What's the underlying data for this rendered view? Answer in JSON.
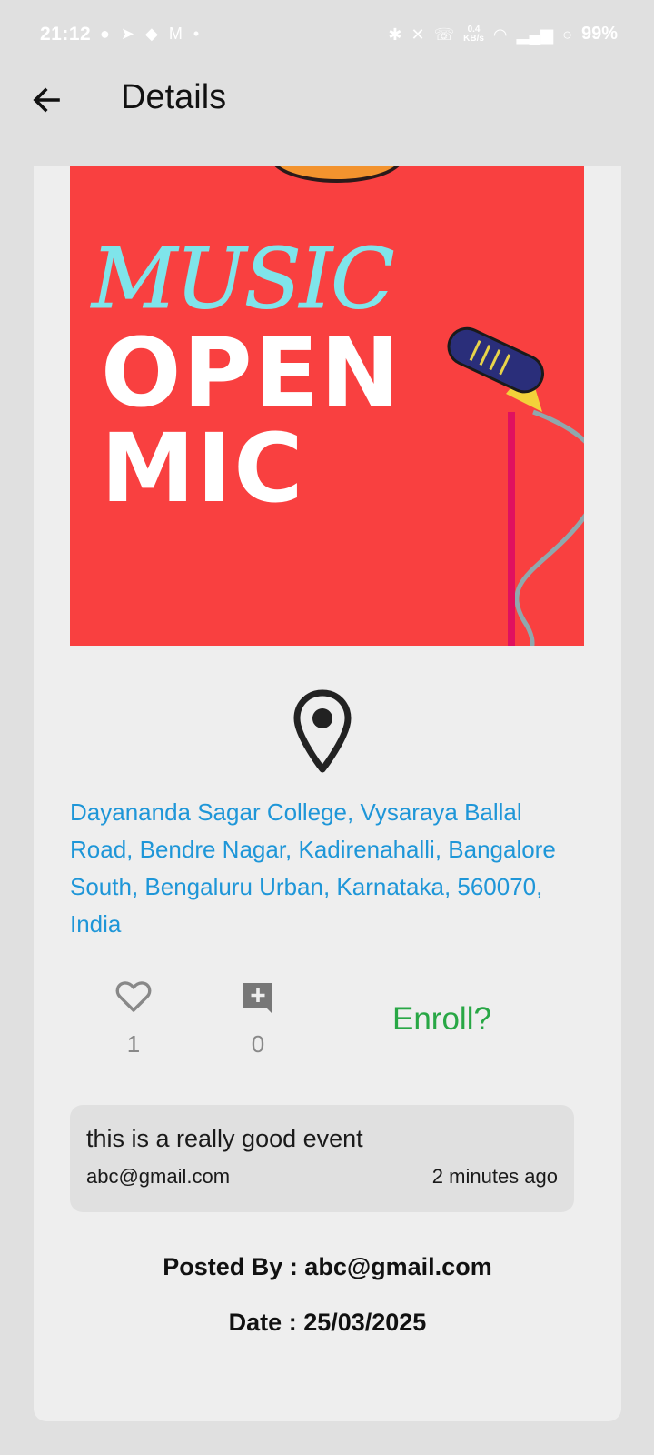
{
  "status_bar": {
    "time": "21:12",
    "net_speed_value": "0.4",
    "net_speed_unit": "KB/s",
    "battery": "99%"
  },
  "app_bar": {
    "title": "Details",
    "back_icon": "arrow-left-icon"
  },
  "poster": {
    "line1": "MUSIC",
    "line2": "OPEN",
    "line3": "MIC",
    "background": "#f94040"
  },
  "event": {
    "location_icon": "map-pin-icon",
    "address": "Dayananda Sagar College, Vysaraya Ballal Road, Bendre Nagar, Kadirenahalli, Bangalore South, Bengaluru Urban, Karnataka, 560070, India",
    "likes": "1",
    "comments_count": "0",
    "enroll_label": "Enroll?",
    "posted_by": "Posted By : abc@gmail.com",
    "date": "Date : 25/03/2025"
  },
  "comments": [
    {
      "text": "this is a really good event",
      "author": "abc@gmail.com",
      "time": "2 minutes ago"
    }
  ],
  "colors": {
    "address": "#1e96d8",
    "enroll": "#28a745",
    "card": "#eeeeee",
    "page": "#e0e0e0"
  }
}
